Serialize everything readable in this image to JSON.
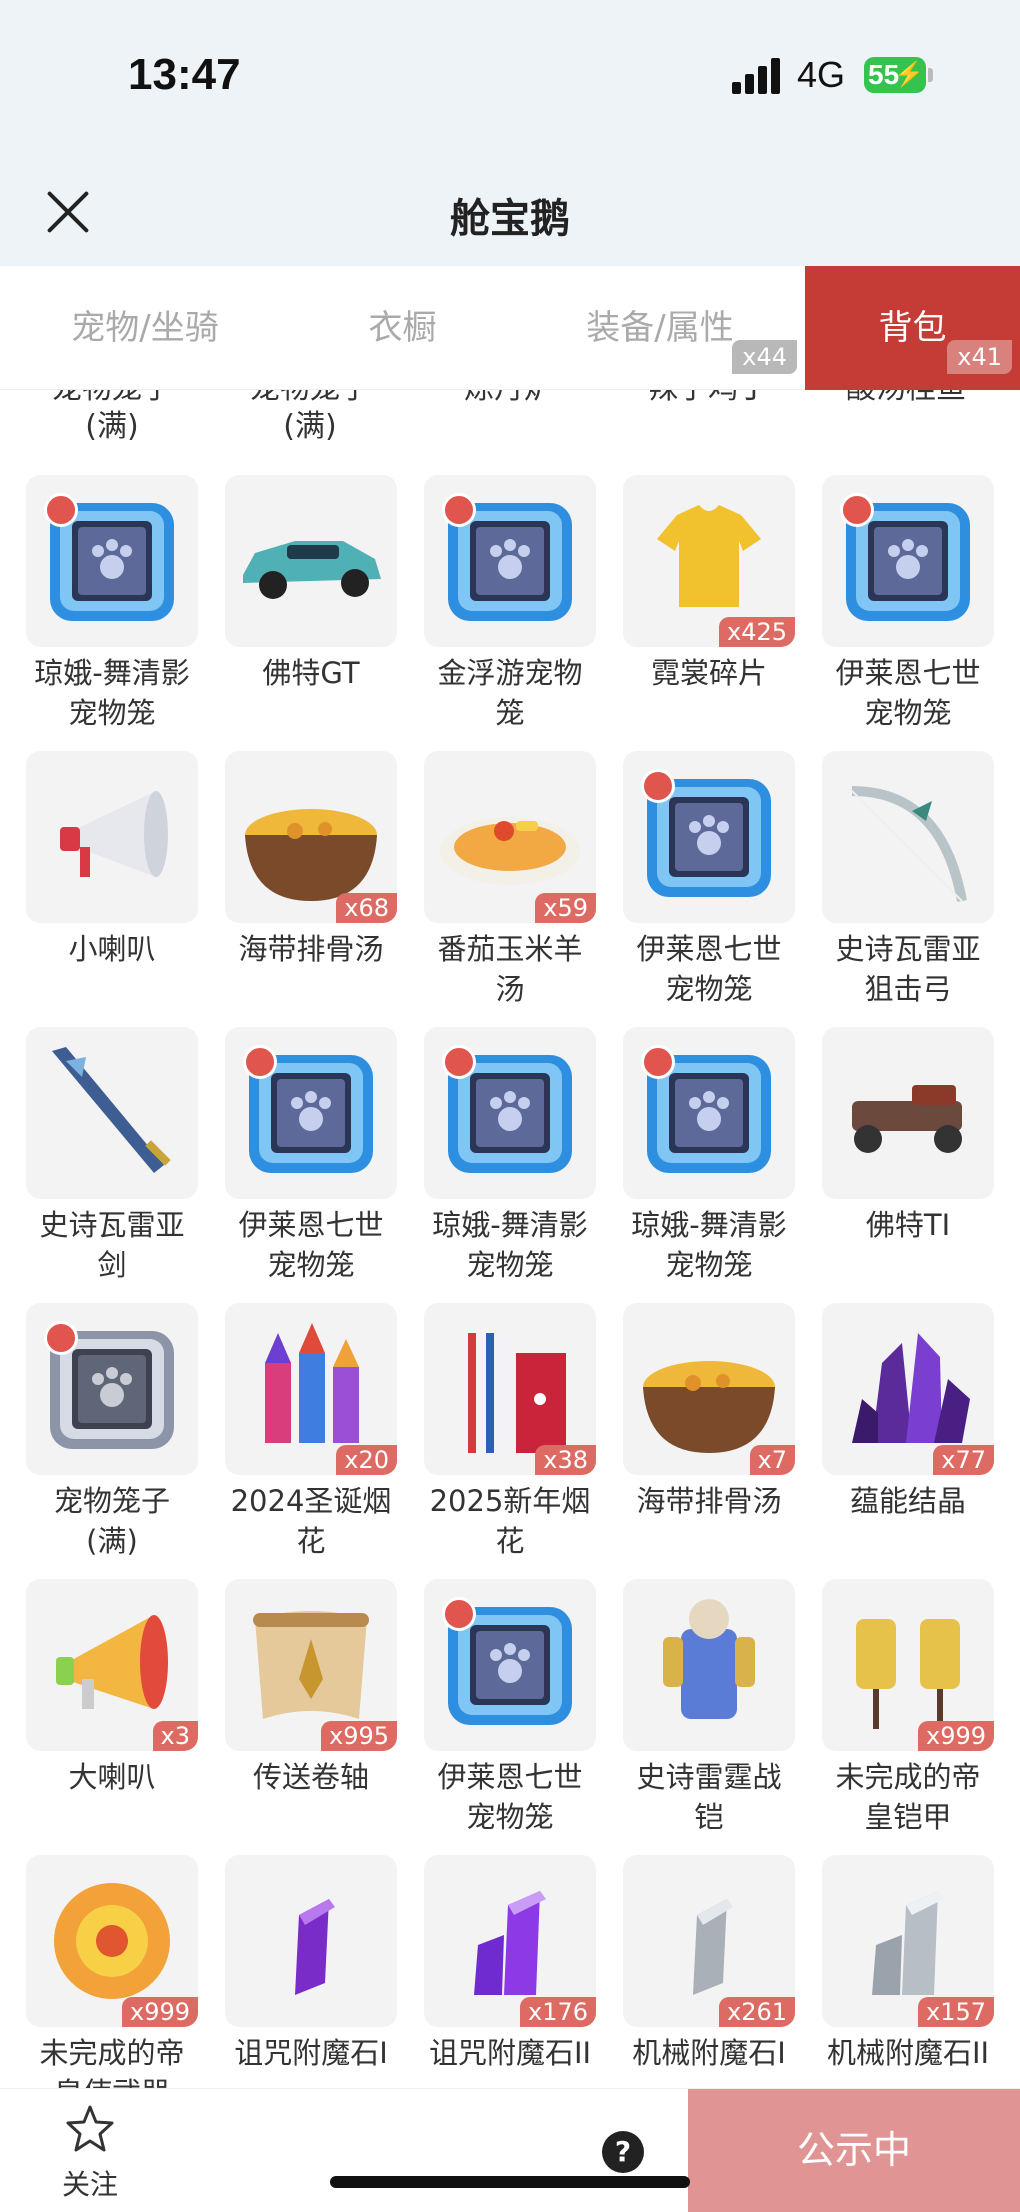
{
  "status": {
    "time": "13:47",
    "network": "4G",
    "battery": "55"
  },
  "nav": {
    "title": "舱宝鹅"
  },
  "tabs": [
    {
      "label": "宠物/坐骑",
      "badge": ""
    },
    {
      "label": "衣橱",
      "badge": ""
    },
    {
      "label": "装备/属性",
      "badge": "x44"
    },
    {
      "label": "背包",
      "badge": "x41",
      "active": true
    }
  ],
  "partial_row": [
    {
      "name": "宠物笼子\n(满)"
    },
    {
      "name": "宠物笼子\n(满)"
    },
    {
      "name": "炼丹炉"
    },
    {
      "name": "辣子鸡丁"
    },
    {
      "name": "酸汤桂鱼"
    }
  ],
  "items": [
    {
      "name": "琼娥-舞清影\n宠物笼",
      "qty": "",
      "icon": "pet-cage-icon"
    },
    {
      "name": "佛特GT",
      "qty": "",
      "icon": "car-icon"
    },
    {
      "name": "金浮游宠物\n笼",
      "qty": "",
      "icon": "pet-cage-icon"
    },
    {
      "name": "霓裳碎片",
      "qty": "x425",
      "icon": "shirt-icon"
    },
    {
      "name": "伊莱恩七世\n宠物笼",
      "qty": "",
      "icon": "pet-cage-icon"
    },
    {
      "name": "小喇叭",
      "qty": "",
      "icon": "megaphone-icon"
    },
    {
      "name": "海带排骨汤",
      "qty": "x68",
      "icon": "soup-icon"
    },
    {
      "name": "番茄玉米羊\n汤",
      "qty": "x59",
      "icon": "soup-plate-icon"
    },
    {
      "name": "伊莱恩七世\n宠物笼",
      "qty": "",
      "icon": "pet-cage-icon"
    },
    {
      "name": "史诗瓦雷亚\n狙击弓",
      "qty": "",
      "icon": "bow-icon"
    },
    {
      "name": "史诗瓦雷亚\n剑",
      "qty": "",
      "icon": "sword-icon"
    },
    {
      "name": "伊莱恩七世\n宠物笼",
      "qty": "",
      "icon": "pet-cage-icon"
    },
    {
      "name": "琼娥-舞清影\n宠物笼",
      "qty": "",
      "icon": "pet-cage-icon"
    },
    {
      "name": "琼娥-舞清影\n宠物笼",
      "qty": "",
      "icon": "pet-cage-icon"
    },
    {
      "name": "佛特TI",
      "qty": "",
      "icon": "car-old-icon"
    },
    {
      "name": "宠物笼子\n(满)",
      "qty": "",
      "icon": "pet-cage-grey-icon"
    },
    {
      "name": "2024圣诞烟\n花",
      "qty": "x20",
      "icon": "firework-icon"
    },
    {
      "name": "2025新年烟\n花",
      "qty": "x38",
      "icon": "firework-box-icon"
    },
    {
      "name": "海带排骨汤",
      "qty": "x7",
      "icon": "soup-icon"
    },
    {
      "name": "蕴能结晶",
      "qty": "x77",
      "icon": "crystal-cluster-icon"
    },
    {
      "name": "大喇叭",
      "qty": "x3",
      "icon": "megaphone-big-icon"
    },
    {
      "name": "传送卷轴",
      "qty": "x995",
      "icon": "scroll-icon"
    },
    {
      "name": "伊莱恩七世\n宠物笼",
      "qty": "",
      "icon": "pet-cage-icon"
    },
    {
      "name": "史诗雷霆战\n铠",
      "qty": "",
      "icon": "armor-icon"
    },
    {
      "name": "未完成的帝\n皇铠甲",
      "qty": "x999",
      "icon": "armor-stand-icon"
    },
    {
      "name": "未完成的帝\n皇使武器",
      "qty": "x999",
      "icon": "fire-orb-icon"
    },
    {
      "name": "诅咒附魔石I",
      "qty": "",
      "icon": "purple-gem-icon"
    },
    {
      "name": "诅咒附魔石II",
      "qty": "x176",
      "icon": "purple-gem2-icon"
    },
    {
      "name": "机械附魔石I",
      "qty": "x261",
      "icon": "silver-gem-icon"
    },
    {
      "name": "机械附魔石II",
      "qty": "x157",
      "icon": "silver-gem2-icon"
    }
  ],
  "bottom": {
    "follow": "关注",
    "help": "?",
    "action": "公示中"
  }
}
